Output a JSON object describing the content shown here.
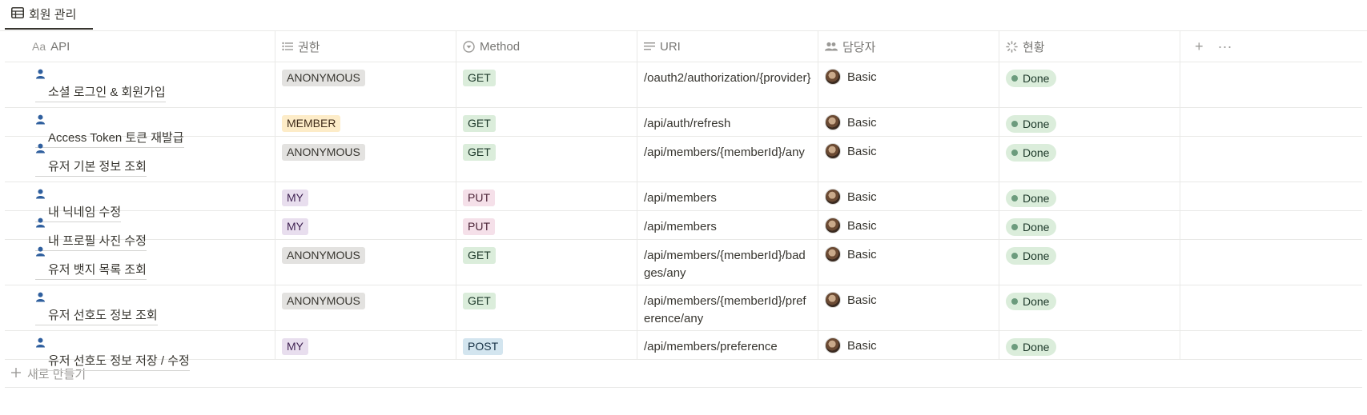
{
  "view_tab": {
    "label": "회원 관리",
    "icon": "table-icon"
  },
  "columns": [
    {
      "label": "API",
      "icon": "Aa"
    },
    {
      "label": "권한",
      "icon": "list-icon"
    },
    {
      "label": "Method",
      "icon": "select-icon"
    },
    {
      "label": "URI",
      "icon": "text-icon"
    },
    {
      "label": "담당자",
      "icon": "people-icon"
    },
    {
      "label": "현황",
      "icon": "status-icon"
    }
  ],
  "header_actions": {
    "add": "+",
    "more": "···"
  },
  "rows": [
    {
      "name": "소셜 로그인 & 회원가입",
      "permission": "ANONYMOUS",
      "method": "GET",
      "uri": "/oauth2/authorization/{provider}",
      "owner": "Basic",
      "status": "Done"
    },
    {
      "name": "Access Token 토큰 재발급",
      "permission": "MEMBER",
      "method": "GET",
      "uri": "/api/auth/refresh",
      "owner": "Basic",
      "status": "Done"
    },
    {
      "name": "유저 기본 정보 조회",
      "permission": "ANONYMOUS",
      "method": "GET",
      "uri": "/api/members/{memberId}/any",
      "owner": "Basic",
      "status": "Done"
    },
    {
      "name": "내 닉네임 수정",
      "permission": "MY",
      "method": "PUT",
      "uri": "/api/members",
      "owner": "Basic",
      "status": "Done"
    },
    {
      "name": "내 프로필 사진 수정",
      "permission": "MY",
      "method": "PUT",
      "uri": "/api/members",
      "owner": "Basic",
      "status": "Done"
    },
    {
      "name": "유저 뱃지 목록 조회",
      "permission": "ANONYMOUS",
      "method": "GET",
      "uri": "/api/members/{memberId}/badges/any",
      "owner": "Basic",
      "status": "Done"
    },
    {
      "name": "유저 선호도 정보 조회",
      "permission": "ANONYMOUS",
      "method": "GET",
      "uri": "/api/members/{memberId}/preference/any",
      "owner": "Basic",
      "status": "Done"
    },
    {
      "name": "유저 선호도 정보 저장 / 수정",
      "permission": "MY",
      "method": "POST",
      "uri": "/api/members/preference",
      "owner": "Basic",
      "status": "Done"
    }
  ],
  "new_row_label": "새로 만들기",
  "colors": {
    "ANONYMOUS": "#e3e2e0",
    "MEMBER": "#fdecc8",
    "MY": "#e8deee",
    "GET": "#dbeddb",
    "PUT": "#f5e0e9",
    "POST": "#d3e5ef",
    "Done": "#dbeddb"
  }
}
